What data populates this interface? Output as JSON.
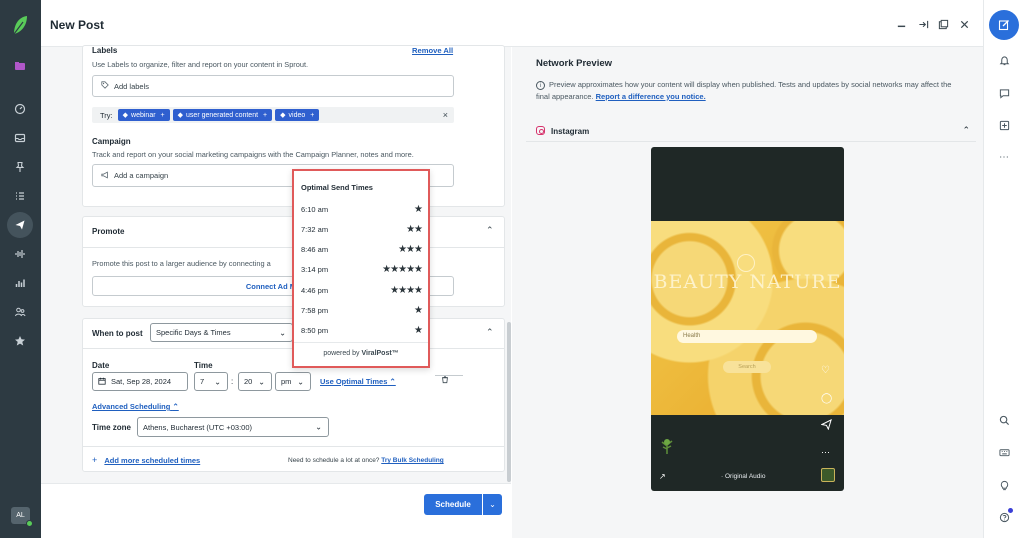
{
  "header": {
    "title": "New Post",
    "icons": [
      "minimize-icon",
      "expand-icon",
      "popout-icon",
      "close-icon"
    ]
  },
  "labels": {
    "title": "Labels",
    "remove_all": "Remove All",
    "description": "Use Labels to organize, filter and report on your content in Sprout.",
    "placeholder": "Add labels",
    "try_label": "Try:",
    "suggestions": [
      "webinar",
      "user generated content",
      "video"
    ],
    "tag_add": "+"
  },
  "campaign": {
    "title": "Campaign",
    "description": "Track and report on your social marketing campaigns with the Campaign Planner, notes and more.",
    "placeholder": "Add a campaign"
  },
  "promote": {
    "title": "Promote",
    "description": "Promote this post to a larger audience by connecting a",
    "button": "Connect Ad Ma"
  },
  "schedule": {
    "when_label": "When to post",
    "when_value": "Specific Days & Times",
    "date_label": "Date",
    "date_value": "Sat, Sep 28, 2024",
    "time_label": "Time",
    "hour": "7",
    "time_sep": ":",
    "minute": "20",
    "ampm": "pm",
    "optimal_link": "Use Optimal Times",
    "advanced": "Advanced Scheduling",
    "tz_label": "Time zone",
    "tz_value": "Athens, Bucharest (UTC +03:00)",
    "add_more": "Add more scheduled times",
    "bulk_prefix": "Need to schedule a lot at once?",
    "bulk_link": "Try Bulk Scheduling",
    "add_plus": "+"
  },
  "footer": {
    "schedule_button": "Schedule"
  },
  "optimal_popover": {
    "title": "Optimal Send Times",
    "times": [
      {
        "time": "6:10 am",
        "stars": 1
      },
      {
        "time": "7:32 am",
        "stars": 2
      },
      {
        "time": "8:46 am",
        "stars": 3
      },
      {
        "time": "3:14 pm",
        "stars": 5
      },
      {
        "time": "4:46 pm",
        "stars": 4
      },
      {
        "time": "7:58 pm",
        "stars": 1
      },
      {
        "time": "8:50 pm",
        "stars": 1
      }
    ],
    "powered_prefix": "powered by",
    "powered_brand": "ViralPost™"
  },
  "preview": {
    "title": "Network Preview",
    "note": "Preview approximates how your content will display when published. Tests and updates by social networks may affect the final appearance.",
    "note_link": "Report a difference you notice.",
    "network": "Instagram",
    "image_title": "BEAUTY NATURE",
    "image_search_placeholder": "Health",
    "image_search_button": "Search",
    "audio": "· Original Audio"
  },
  "user": {
    "initials": "AL"
  },
  "colors": {
    "accent": "#2a6fdb",
    "nav_bg": "#2d3a42",
    "tag_bg": "#2f5fcf",
    "highlight": "#e05a5a"
  }
}
